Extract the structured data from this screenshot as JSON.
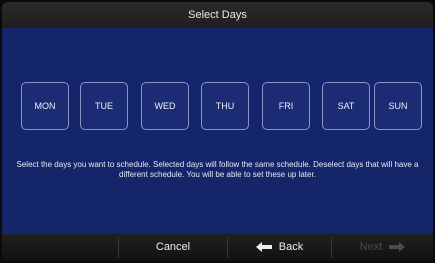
{
  "title": "Select Days",
  "days": [
    {
      "label": "MON"
    },
    {
      "label": "TUE"
    },
    {
      "label": "WED"
    },
    {
      "label": "THU"
    },
    {
      "label": "FRI"
    },
    {
      "label": "SAT"
    },
    {
      "label": "SUN"
    }
  ],
  "instructions": "Select the days you want to schedule.  Selected days will follow the same schedule.  Deselect days that will have a different schedule.  You will be able to set these up later.",
  "footer": {
    "cancel_label": "Cancel",
    "back_label": "Back",
    "next_label": "Next"
  },
  "colors": {
    "panel": "#15256a",
    "day_button": "#1b2b74",
    "footer": "#111111",
    "next_disabled": "#4a4a4a"
  }
}
